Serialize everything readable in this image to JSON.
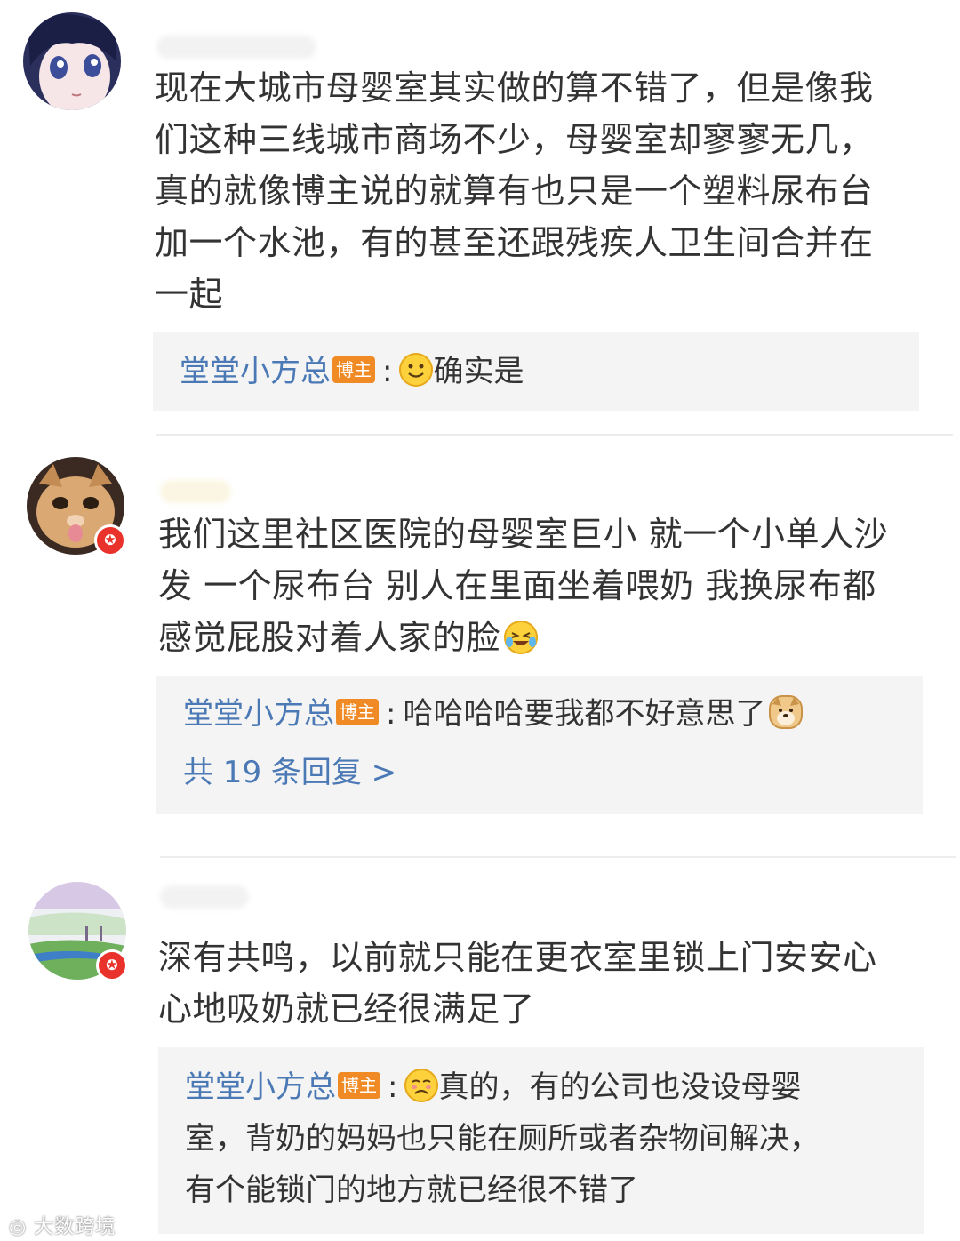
{
  "comments": [
    {
      "text_lines": [
        "现在大城市母婴室其实做的算不错了，但是像我",
        "们这种三线城市商场不少，母婴室却寥寥无几，",
        "真的就像博主说的就算有也只是一个塑料尿布台",
        "加一个水池，有的甚至还跟残疾人卫生间合并在",
        "一起"
      ],
      "reply": {
        "author": "堂堂小方总",
        "tag": "博主",
        "colon": ":",
        "emoji": "smile-emoji",
        "text": "确实是"
      }
    },
    {
      "text_lines": [
        "我们这里社区医院的母婴室巨小 就一个小单人沙",
        "发 一个尿布台 别人在里面坐着喂奶 我换尿布都",
        "感觉屁股对着人家的脸"
      ],
      "text_emoji": "laugh-cry-emoji",
      "reply": {
        "author": "堂堂小方总",
        "tag": "博主",
        "colon": ":",
        "text": "哈哈哈哈要我都不好意思了",
        "emoji": "doge-emoji"
      },
      "more_replies": "共 19 条回复 >"
    },
    {
      "text_lines": [
        "深有共鸣，以前就只能在更衣室里锁上门安安心",
        "心地吸奶就已经很满足了"
      ],
      "reply": {
        "author": "堂堂小方总",
        "tag": "博主",
        "colon": ":",
        "emoji": "sad-emoji",
        "text_lines": [
          "真的，有的公司也没设母婴",
          "室，背奶的妈妈也只能在厕所或者杂物间解决，",
          "有个能锁门的地方就已经很不错了"
        ]
      }
    }
  ],
  "badges": {
    "vip_symbol": "✪"
  },
  "watermark": "大数跨境",
  "colors": {
    "link_blue": "#4b79b5",
    "blogger_tag": "#f08a24",
    "reply_bg": "#f4f4f4",
    "vip_red": "#e8322b"
  }
}
